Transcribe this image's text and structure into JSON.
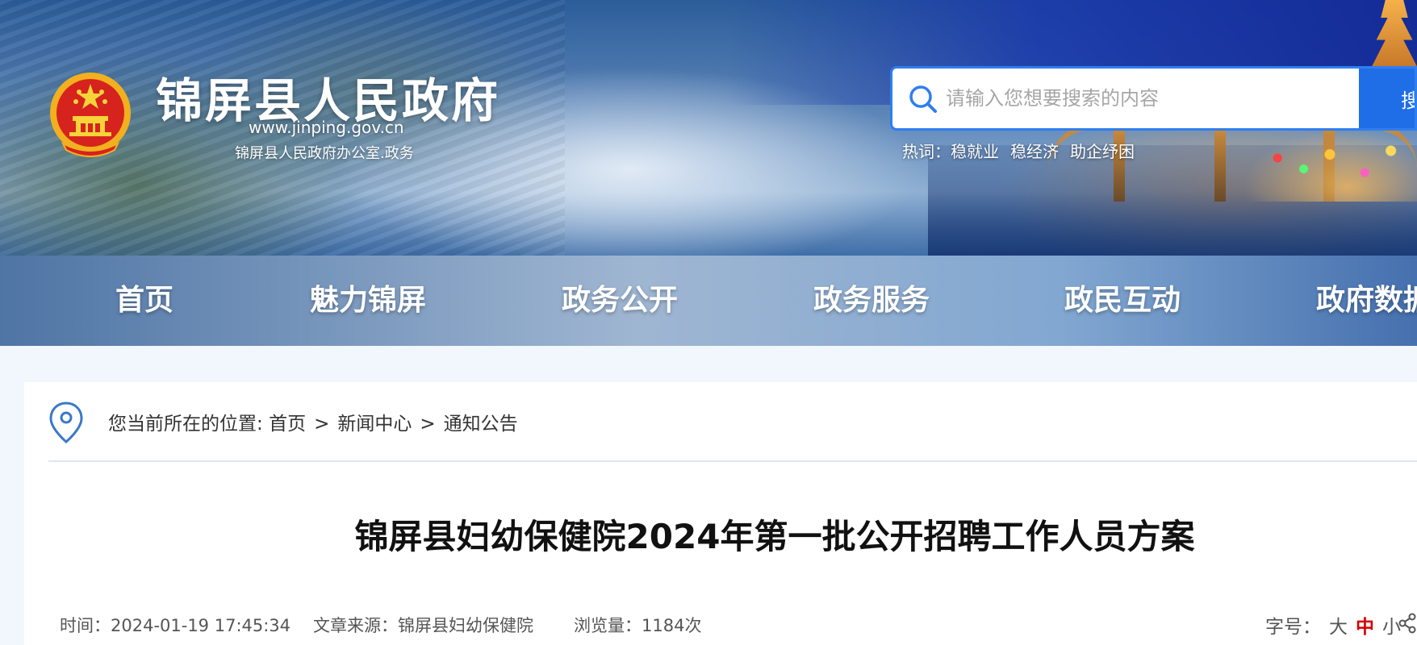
{
  "header": {
    "site_title": "锦屏县人民政府",
    "site_url": "www.jinping.gov.cn",
    "site_office": "锦屏县人民政府办公室.政务"
  },
  "search": {
    "placeholder": "请输入您想要搜索的内容",
    "button_label": "搜",
    "hotwords_label": "热词：",
    "hotwords": [
      "稳就业",
      "稳经济",
      "助企纾困"
    ]
  },
  "nav": {
    "items": [
      "首页",
      "魅力锦屏",
      "政务公开",
      "政务服务",
      "政民互动",
      "政府数据"
    ]
  },
  "breadcrumb": {
    "prefix": "您当前所在的位置:",
    "items": [
      "首页",
      "新闻中心",
      "通知公告"
    ],
    "separator": ">"
  },
  "article": {
    "title": "锦屏县妇幼保健院2024年第一批公开招聘工作人员方案",
    "time_label": "时间：",
    "time_value": "2024-01-19 17:45:34",
    "source_label": "文章来源：",
    "source_value": "锦屏县妇幼保健院",
    "views_label": "浏览量：",
    "views_value": "1184次"
  },
  "font_size": {
    "label": "字号：",
    "options": [
      "大",
      "中",
      "小"
    ],
    "active": "中"
  },
  "colors": {
    "accent": "#1f6ee8",
    "active_font_size": "#d40000"
  },
  "icons": [
    "national-emblem",
    "search-icon",
    "location-pin-icon",
    "share-icon"
  ]
}
